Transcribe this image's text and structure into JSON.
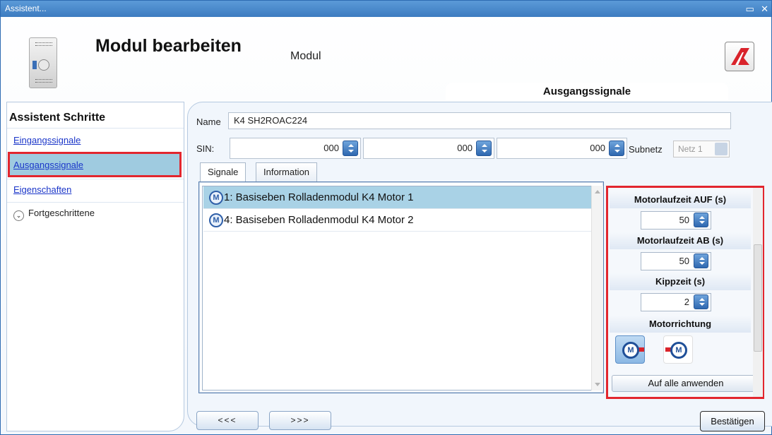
{
  "window": {
    "title": "Assistent..."
  },
  "header": {
    "title": "Modul bearbeiten",
    "subtitle": "Modul",
    "section": "Ausgangssignale"
  },
  "steps": {
    "heading": "Assistent Schritte",
    "items": [
      {
        "label": "Eingangssignale",
        "active": false
      },
      {
        "label": "Ausgangssignale",
        "active": true
      },
      {
        "label": "Eigenschaften",
        "active": false
      }
    ],
    "advanced": "Fortgeschrittene"
  },
  "form": {
    "name_label": "Name",
    "name_value": "K4 SH2ROAC224",
    "sin_label": "SIN:",
    "sin_values": [
      "000",
      "000",
      "000"
    ],
    "subnet_label": "Subnetz",
    "subnet_value": "Netz 1"
  },
  "tabs": [
    "Signale",
    "Information"
  ],
  "signals": [
    {
      "label": "1: Basiseben Rolladenmodul K4 Motor 1",
      "selected": true
    },
    {
      "label": "4: Basiseben Rolladenmodul K4 Motor 2",
      "selected": false
    }
  ],
  "properties": {
    "up_time_label": "Motorlaufzeit AUF (s)",
    "up_time_value": "50",
    "down_time_label": "Motorlaufzeit AB (s)",
    "down_time_value": "50",
    "tilt_label": "Kippzeit (s)",
    "tilt_value": "2",
    "direction_label": "Motorrichtung",
    "direction_icon_1": "motor-right-icon",
    "direction_icon_2": "motor-left-icon",
    "apply_label": "Auf alle anwenden"
  },
  "nav": {
    "back_label": "<<<",
    "next_label": ">>>",
    "confirm_label": "Bestätigen"
  },
  "colors": {
    "accent": "#3d7cc0",
    "highlight": "#e2262e",
    "selection": "#a9d2e6"
  }
}
